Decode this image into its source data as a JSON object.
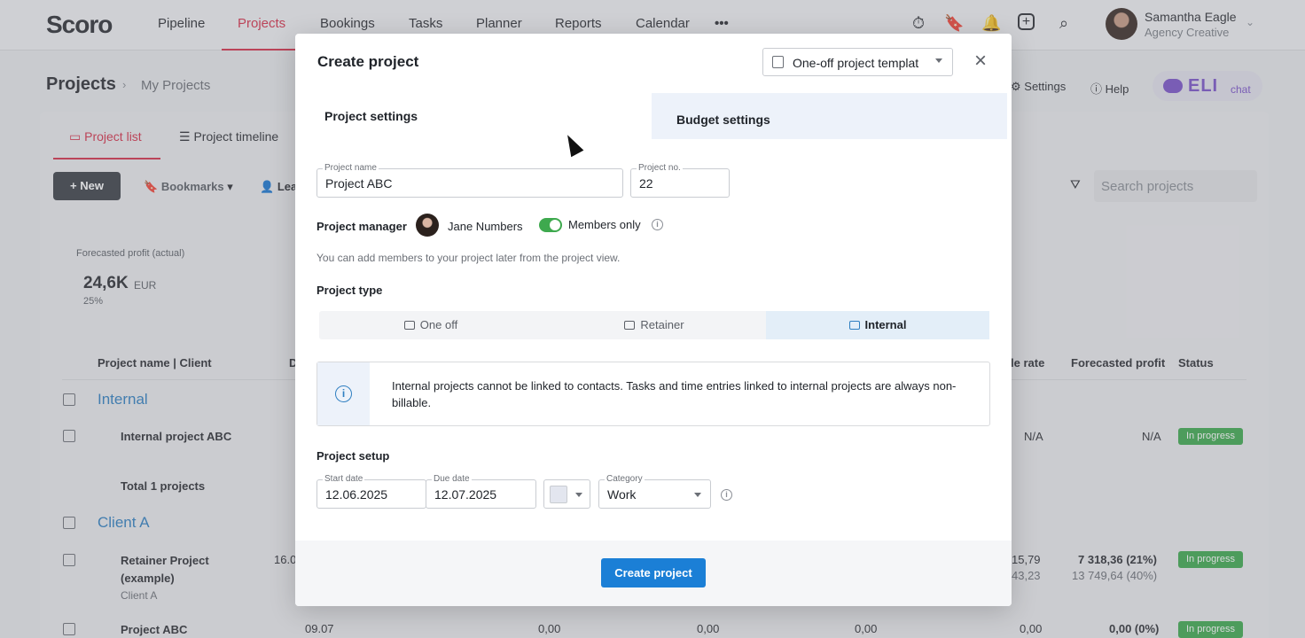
{
  "app": {
    "logo": "Scoro",
    "nav": [
      "Pipeline",
      "Projects",
      "Bookings",
      "Tasks",
      "Planner",
      "Reports",
      "Calendar",
      "•••"
    ],
    "user": {
      "name": "Samantha Eagle",
      "org": "Agency Creative"
    },
    "accent": "#d6304a"
  },
  "page": {
    "title": "Projects",
    "breadcrumb": "My Projects",
    "settings": "Settings",
    "help": "Help",
    "eli": "ELI",
    "eli_chat": "chat",
    "tabs": [
      "Project list",
      "Project timeline"
    ],
    "new_button": "+ New",
    "bookmarks": "Bookmarks",
    "lea": "Lea",
    "search_placeholder": "Search projects",
    "kpi": {
      "label": "Forecasted profit (actual)",
      "value": "24,6K",
      "unit": "EUR",
      "pct": "25%"
    },
    "columns": {
      "name": "Project name | Client",
      "d": "D",
      "rate": "le rate",
      "profit": "Forecasted profit",
      "status": "Status"
    },
    "groups": [
      {
        "name": "Internal"
      },
      {
        "name": "Client A"
      }
    ],
    "rows": {
      "internal_project": {
        "name": "Internal project ABC",
        "rate": "N/A",
        "profit": "N/A",
        "status": "In progress"
      },
      "total": "Total 1 projects",
      "retainer": {
        "name": "Retainer Project",
        "name2": "(example)",
        "client": "Client A",
        "date": "16.0",
        "rate1": "15,79",
        "rate2": "43,23",
        "profit1": "7 318,36 (21%)",
        "profit2": "13 749,64 (40%)",
        "status": "In progress"
      },
      "abc": {
        "name": "Project ABC",
        "date": "09.07",
        "v1": "0,00",
        "v2": "0,00",
        "v3": "0,00",
        "v4": "0,00",
        "profit": "0,00 (0%)",
        "status": "In progress"
      }
    }
  },
  "modal": {
    "title": "Create project",
    "template": "One-off project templat",
    "tabs": {
      "project_settings": "Project settings",
      "budget_settings": "Budget settings"
    },
    "project_name": {
      "label": "Project name",
      "value": "Project ABC"
    },
    "project_no": {
      "label": "Project no.",
      "value": "22"
    },
    "project_manager": {
      "label": "Project manager",
      "name": "Jane Numbers"
    },
    "members_only": {
      "label": "Members only",
      "on": true
    },
    "hint": "You can add members to your project later from the project view.",
    "project_type": {
      "label": "Project type",
      "options": [
        "One off",
        "Retainer",
        "Internal"
      ],
      "selected": "Internal"
    },
    "notice": "Internal projects cannot be linked to contacts. Tasks and time entries linked to internal projects are always non-billable.",
    "setup": {
      "label": "Project setup",
      "start_date": {
        "label": "Start date",
        "value": "12.06.2025"
      },
      "due_date": {
        "label": "Due date",
        "value": "12.07.2025"
      },
      "category": {
        "label": "Category",
        "value": "Work"
      }
    },
    "create_button": "Create project",
    "primary_color": "#1b7fd6"
  }
}
